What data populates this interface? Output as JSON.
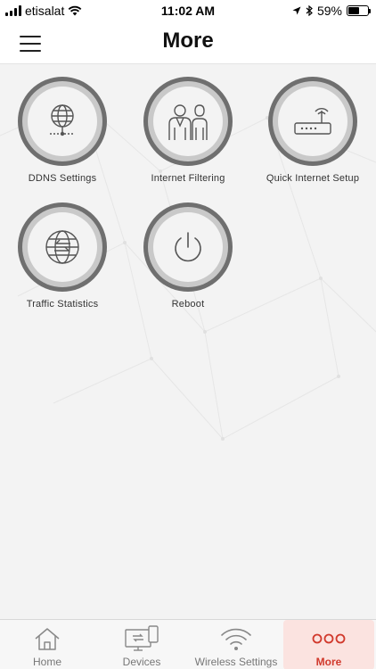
{
  "status_bar": {
    "carrier": "etisalat",
    "time": "11:02 AM",
    "battery_percent": "59%",
    "battery_level": 0.59
  },
  "header": {
    "title": "More"
  },
  "tiles": [
    {
      "label": "DDNS Settings",
      "icon": "globe-network-icon"
    },
    {
      "label": "Internet Filtering",
      "icon": "people-icon"
    },
    {
      "label": "Quick Internet Setup",
      "icon": "router-icon"
    },
    {
      "label": "Traffic Statistics",
      "icon": "globe-arrows-icon"
    },
    {
      "label": "Reboot",
      "icon": "power-icon"
    }
  ],
  "tabbar": {
    "tabs": [
      {
        "label": "Home",
        "icon": "home-icon"
      },
      {
        "label": "Devices",
        "icon": "devices-icon"
      },
      {
        "label": "Wireless Settings",
        "icon": "wifi-icon"
      },
      {
        "label": "More",
        "icon": "more-dots-icon",
        "active": true
      }
    ]
  },
  "colors": {
    "accent": "#d1392c",
    "active_tab_bg": "#fbe3e0",
    "ring_dark": "#6f6f6f",
    "ring_light": "#c9c9c9"
  }
}
